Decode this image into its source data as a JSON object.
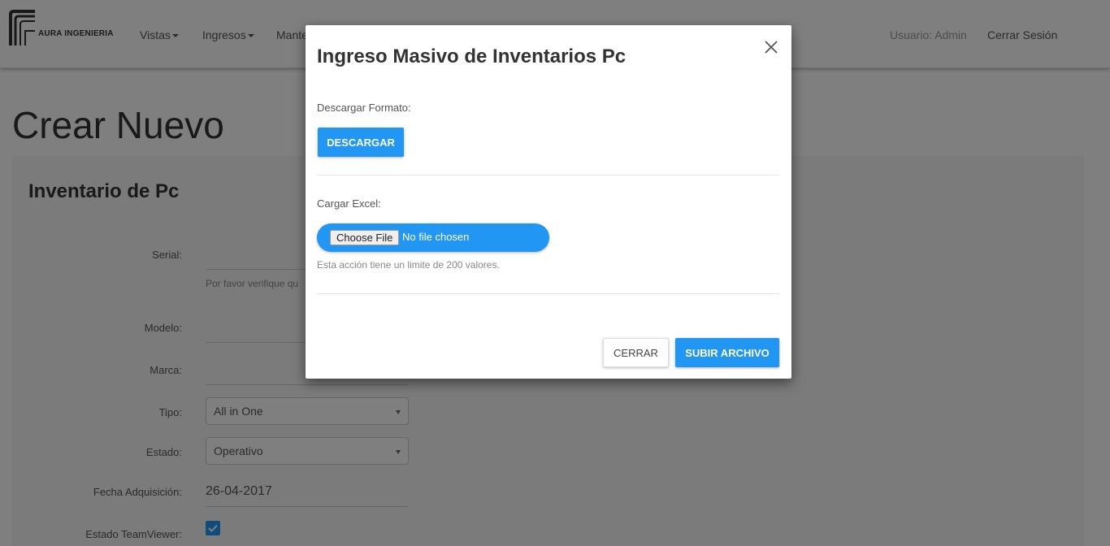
{
  "nav": {
    "logo_text": "AURA INGENIERIA",
    "items": [
      {
        "label": "Vistas"
      },
      {
        "label": "Ingresos"
      },
      {
        "label": "Mante"
      }
    ],
    "user": "Usuario: Admin",
    "logout": "Cerrar Sesión"
  },
  "page": {
    "title": "Crear Nuevo",
    "panel_title": "Inventario de Pc"
  },
  "form": {
    "serial_label": "Serial:",
    "serial_help": "Por favor verifique qu",
    "modelo_label": "Modelo:",
    "marca_label": "Marca:",
    "tipo_label": "Tipo:",
    "tipo_value": "All in One",
    "estado_label": "Estado:",
    "estado_value": "Operativo",
    "fecha_label": "Fecha Adquisición:",
    "fecha_value": "26-04-2017",
    "teamviewer_label": "Estado TeamViewer:",
    "teamviewer_checked": true
  },
  "modal": {
    "title": "Ingreso Masivo de Inventarios Pc",
    "download_label": "Descargar Formato:",
    "download_button": "DESCARGAR",
    "upload_label": "Cargar Excel:",
    "file_button": "Choose File",
    "file_status": "No file chosen",
    "help_text": "Esta acción tiene un limite de 200 valores.",
    "close_button": "CERRAR",
    "submit_button": "SUBIR ARCHIVO"
  },
  "colors": {
    "primary": "#2196f3",
    "backdrop": "rgba(0,0,0,0.5)"
  },
  "icons": {
    "close": "close-icon",
    "caret": "caret-down-icon",
    "logo": "aura-logo-icon",
    "check": "checkmark-icon"
  }
}
